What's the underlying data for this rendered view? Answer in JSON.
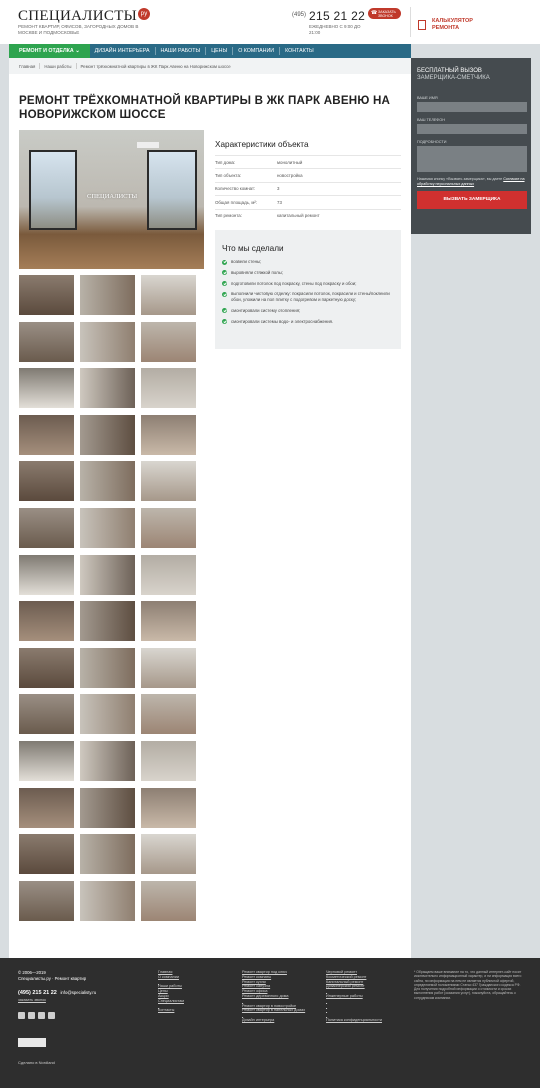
{
  "header": {
    "logo": "СПЕЦИАЛИСТЫ",
    "logo_badge": "ру",
    "tagline": "РЕМОНТ КВАРТИР, ОФИСОВ, ЗАГОРОДНЫХ ДОМОВ В МОСКВЕ И ПОДМОСКОВЬЕ",
    "phone_code": "(495)",
    "phone_number": "215 21 22",
    "hours": "ЕЖЕДНЕВНО С 9:00 ДО 21:00",
    "callback_label": "ЗАКАЗАТЬ ЗВОНОК",
    "calc_label": "КАЛЬКУЛЯТОР РЕМОНТА"
  },
  "nav": {
    "items": [
      "РЕМОНТ И ОТДЕЛКА",
      "ДИЗАЙН ИНТЕРЬЕРА",
      "НАШИ РАБОТЫ",
      "ЦЕНЫ",
      "О КОМПАНИИ",
      "КОНТАКТЫ"
    ]
  },
  "breadcrumbs": [
    "Главная",
    "Наши работы",
    "Ремонт трёхкомнатной квартиры в ЖК Парк Авеню на Новорижском шоссе"
  ],
  "page_title": "РЕМОНТ ТРЁХКОМНАТНОЙ КВАРТИРЫ В ЖК ПАРК АВЕНЮ НА НОВОРИЖСКОМ ШОССЕ",
  "photo_watermark": "СПЕЦИАЛИСТЫ",
  "characteristics": {
    "title": "Характеристики объекта",
    "rows": [
      {
        "key": "Тип дома:",
        "value": "монолитный"
      },
      {
        "key": "Тип объекта:",
        "value": "новостройка"
      },
      {
        "key": "Количество комнат:",
        "value": "3"
      },
      {
        "key": "Общая площадь, м²:",
        "value": "73"
      },
      {
        "key": "Тип ремонта:",
        "value": "капитальный ремонт"
      }
    ]
  },
  "done": {
    "title": "Что мы сделали",
    "items": [
      "возвели стены;",
      "выровняли стяжкой полы;",
      "подготовили потолок под покраску, стены под покраску и обои;",
      "выполнили чистовую отделку: покрасили потолок, покрасили и стены/поклеили обои, уложили на пол плитку с подогревом и паркетную доску;",
      "смонтировали систему отопления;",
      "смонтировали системы водо- и электроснабжения."
    ]
  },
  "sidebar": {
    "title": "БЕСПЛАТНЫЙ ВЫЗОВ",
    "subtitle": "ЗАМЕРЩИКА-СМЕТЧИКА",
    "name_label": "ВАШЕ ИМЯ",
    "phone_label": "ВАШ ТЕЛЕФОН",
    "details_label": "ПОДРОБНОСТИ",
    "note": "Нажимая кнопку «Вызвать замерщика», вы даете",
    "consent_link": "Согласие на обработку персональных данных",
    "button": "ВЫЗВАТЬ ЗАМЕРЩИКА"
  },
  "footer": {
    "copyright": "© 2006—2019",
    "company": "Специалисты.ру · Ремонт квартир",
    "phone": "(495) 215 21 22",
    "email": "info@specialisty.ru",
    "order_call": "заказать звонок",
    "made_by": "Сделано в Nordland",
    "col1": [
      "Главная",
      "О компании",
      "",
      "Наши работы",
      "Цены",
      "Акции",
      "Специалистам",
      "",
      "Контакты"
    ],
    "col2": [
      "Ремонт квартир под ключ",
      "Ремонт комнаты",
      "Ремонт кухни",
      "Ремонт санузла",
      "Ремонт офиса",
      "Ремонт деревянного дома",
      "",
      "Ремонт квартир в новостройке",
      "Ремонт квартир в панельных домах",
      "",
      "Дизайн интерьера"
    ],
    "col3": [
      "Черновой ремонт",
      "Косметический ремонт",
      "Капитальный ремонт",
      "Дизайнерский ремонт",
      "",
      "Инженерные работы",
      "",
      "",
      "",
      "",
      "Политика конфиденциальности"
    ],
    "disclaimer": "* Обращаем ваше внимание на то, что данный интернет-сайт носит исключительно информационный характер, и ни информация всего сайта, ни информация на нем не является публичной офертой, определяемой положениями Статьи 437 Гражданского кодекса РФ. Для получения подробной информации о стоимости и сроках выполнения работ (оказания услуг), пожалуйста, обращайтесь к сотрудникам компании."
  },
  "colors": {
    "nav": "#2a6a86",
    "nav_active": "#2ea44f",
    "accent_red": "#c0392b",
    "sidebar_bg": "#454b4f",
    "footer_bg": "#2e2e2e"
  }
}
